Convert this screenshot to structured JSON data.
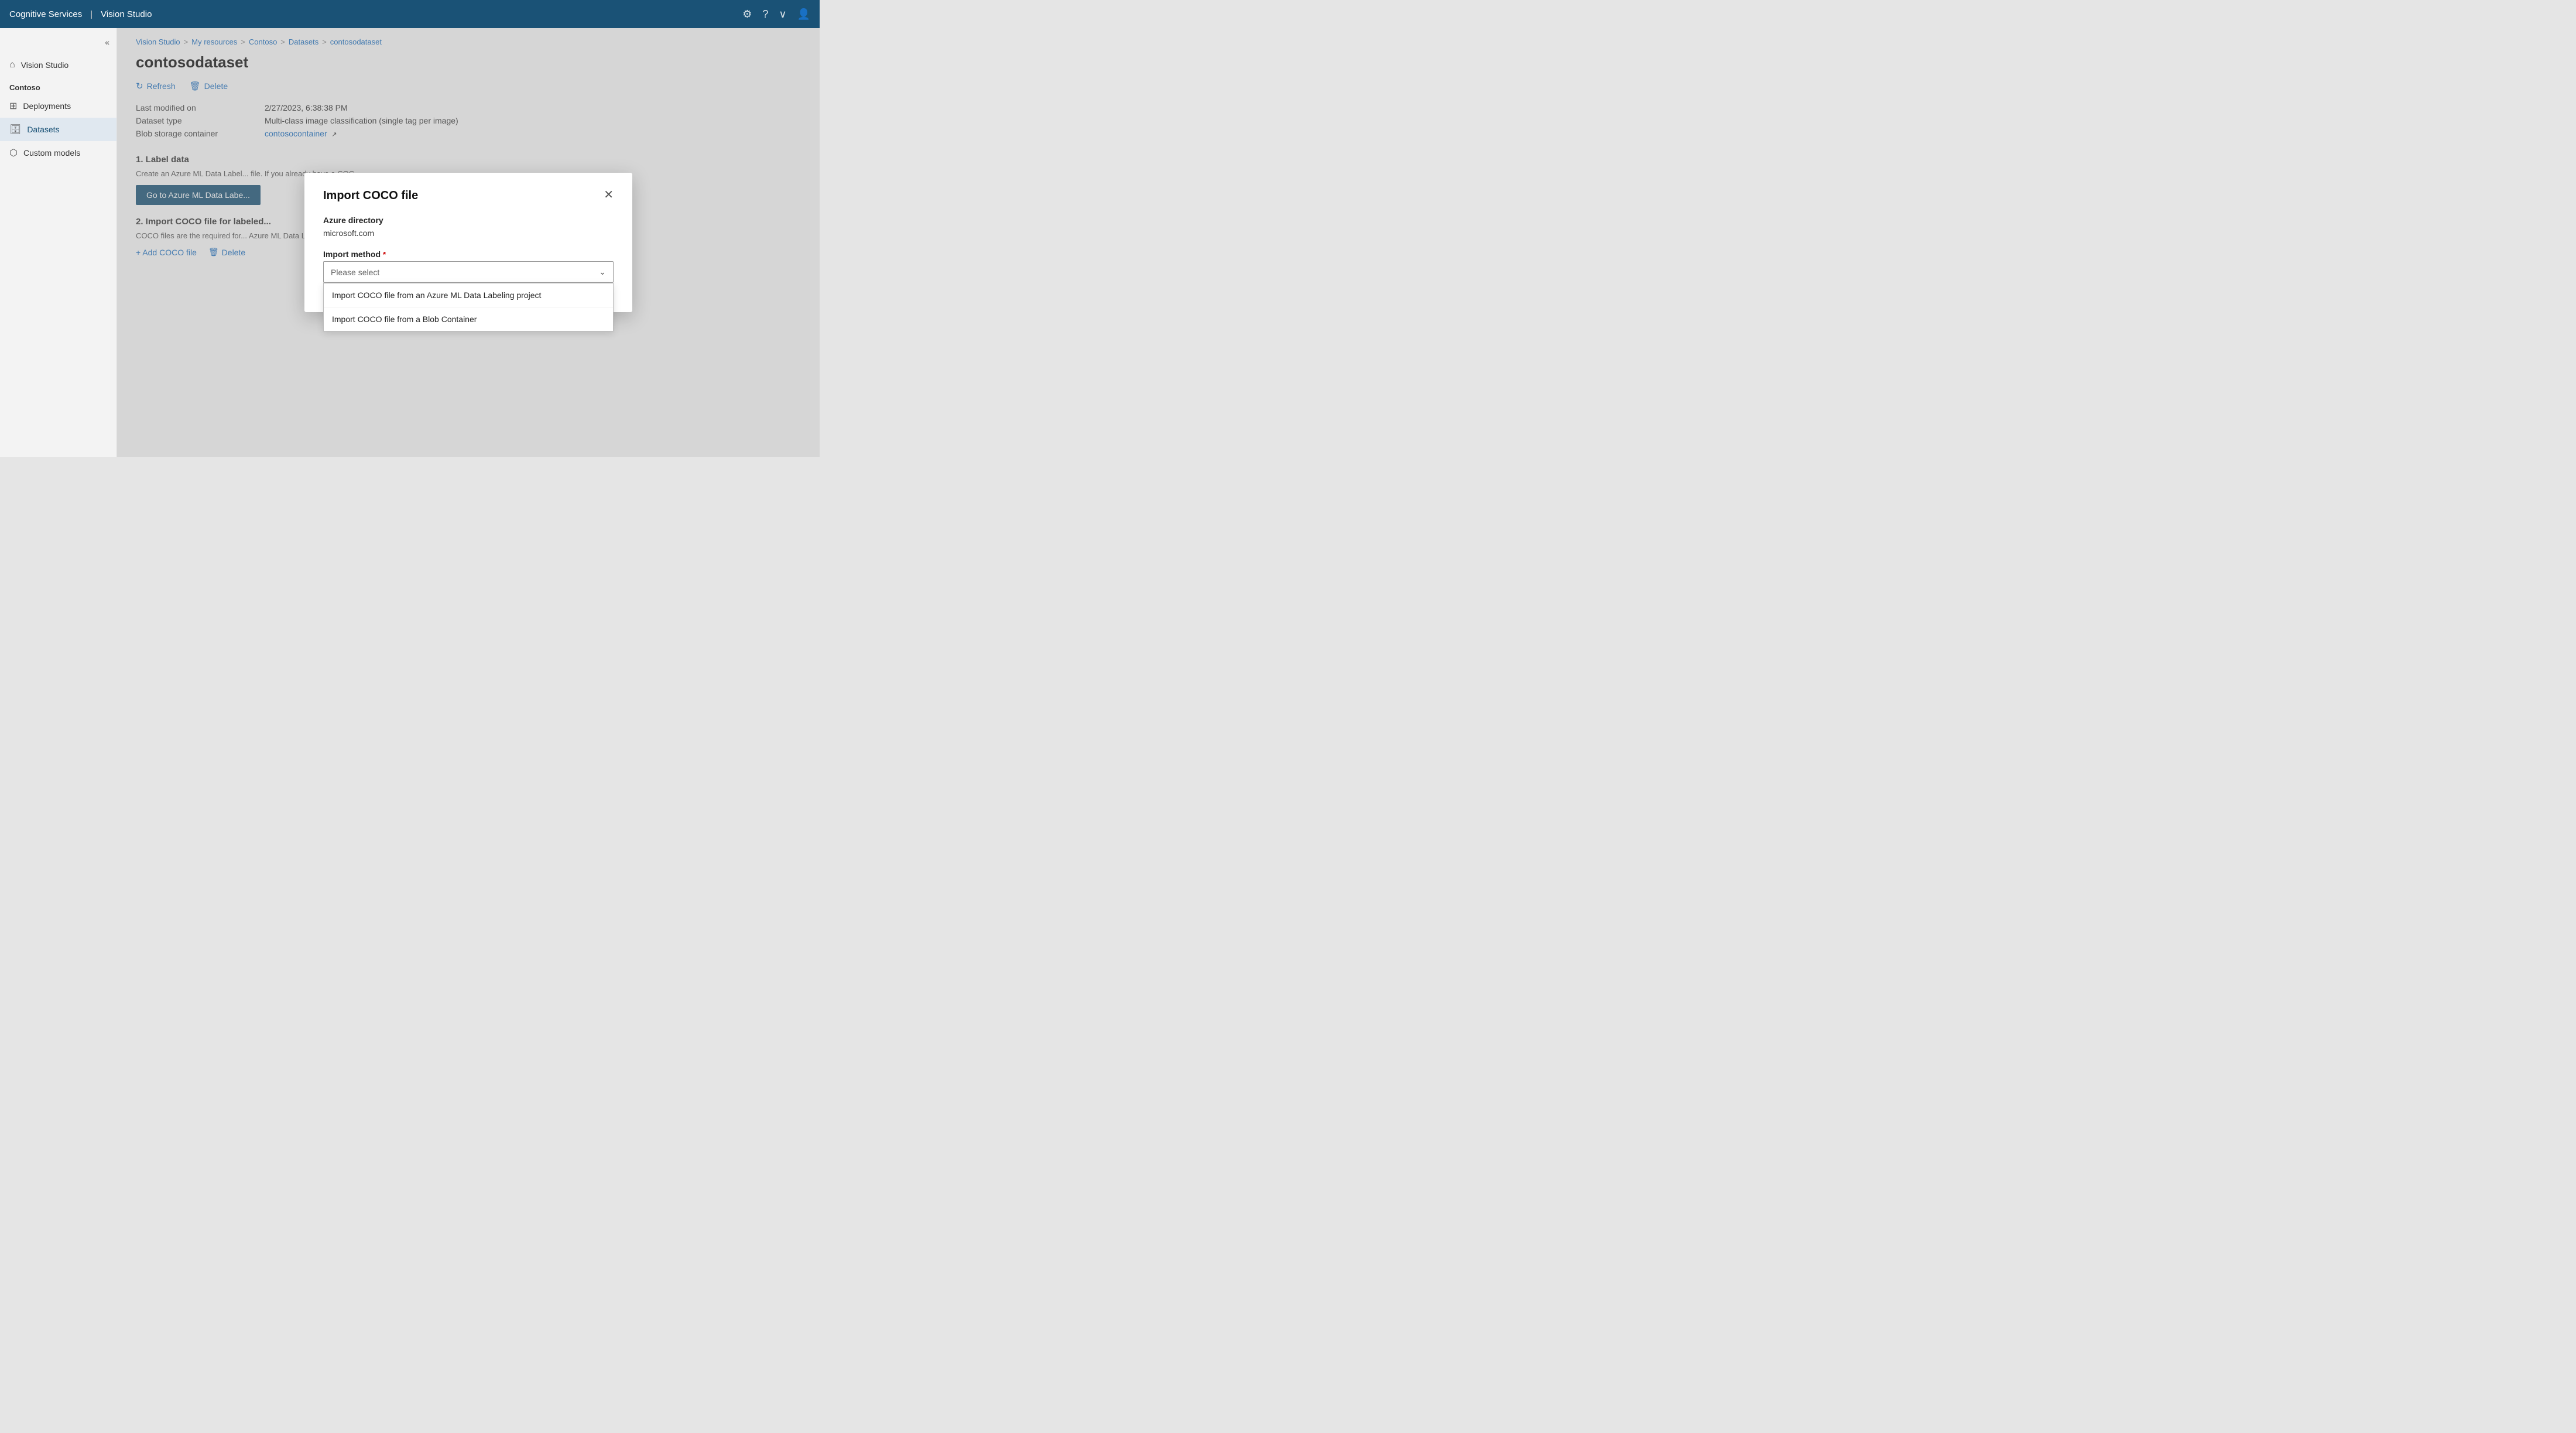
{
  "app": {
    "title": "Cognitive Services",
    "subtitle": "Vision Studio",
    "divider": "|"
  },
  "topnav": {
    "settings_icon": "⚙",
    "help_icon": "?",
    "dropdown_icon": "∨",
    "avatar_icon": "👤"
  },
  "sidebar": {
    "collapse_icon": "«",
    "home_icon": "⌂",
    "home_label": "Vision Studio",
    "group_label": "Contoso",
    "deployments_icon": "⊞",
    "deployments_label": "Deployments",
    "datasets_icon": "🗄",
    "datasets_label": "Datasets",
    "custommodels_icon": "⬡",
    "custommodels_label": "Custom models"
  },
  "breadcrumb": {
    "items": [
      "Vision Studio",
      "My resources",
      "Contoso",
      "Datasets",
      "contosodataset"
    ],
    "separators": [
      ">",
      ">",
      ">",
      ">"
    ]
  },
  "page": {
    "title": "contosodataset",
    "refresh_label": "Refresh",
    "delete_label": "Delete",
    "meta": {
      "last_modified_label": "Last modified on",
      "last_modified_value": "2/27/2023, 6:38:38 PM",
      "dataset_type_label": "Dataset type",
      "dataset_type_value": "Multi-class image classification (single tag per image)",
      "blob_container_label": "Blob storage container",
      "blob_container_value": "contosocontainer",
      "blob_container_icon": "↗"
    },
    "section1": {
      "title": "1. Label data",
      "description": "Create an Azure ML Data Label... file. If you already have a COC...",
      "button_label": "Go to Azure ML Data Labe..."
    },
    "section2": {
      "title": "2. Import COCO file for labeled...",
      "description": "COCO files are the required for... Azure ML Data Labeling projec...",
      "add_coco_label": "+ Add COCO file",
      "delete_label": "Delete"
    }
  },
  "modal": {
    "title": "Import COCO file",
    "close_icon": "✕",
    "azure_directory_label": "Azure directory",
    "azure_directory_value": "microsoft.com",
    "import_method_label": "Import method",
    "required_indicator": "*",
    "dropdown_placeholder": "Please select",
    "dropdown_options": [
      "Import COCO file from an Azure ML Data Labeling project",
      "Import COCO file from a Blob Container"
    ]
  }
}
